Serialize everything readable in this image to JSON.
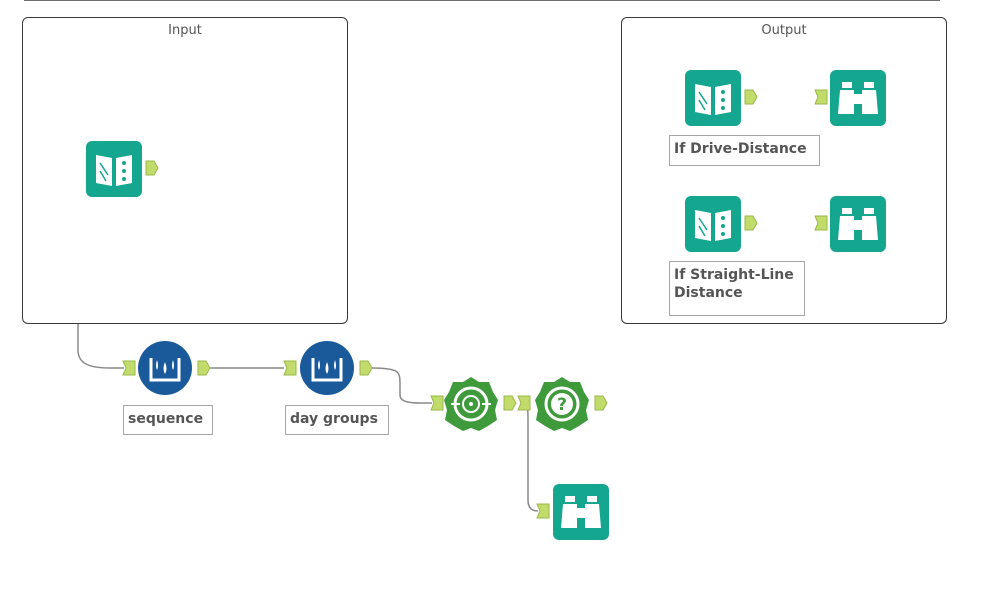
{
  "containers": {
    "input": {
      "title": "Input"
    },
    "output": {
      "title": "Output"
    }
  },
  "tools": {
    "input_data": {
      "icon": "book-icon",
      "type": "Input Data"
    },
    "multi_row_1": {
      "icon": "multi-row-formula-icon",
      "type": "Multi-Row Formula"
    },
    "multi_row_2": {
      "icon": "multi-row-formula-icon",
      "type": "Multi-Row Formula"
    },
    "spatial_1": {
      "icon": "spatial-process-icon",
      "type": "Spatial"
    },
    "spatial_2": {
      "icon": "spatial-question-icon",
      "type": "Spatial"
    },
    "browse_main": {
      "icon": "binoculars-icon",
      "type": "Browse"
    },
    "out_input_1": {
      "icon": "book-icon",
      "type": "Input Data"
    },
    "out_browse_1": {
      "icon": "binoculars-icon",
      "type": "Browse"
    },
    "out_input_2": {
      "icon": "book-icon",
      "type": "Input Data"
    },
    "out_browse_2": {
      "icon": "binoculars-icon",
      "type": "Browse"
    }
  },
  "annotations": {
    "sequence": "sequence",
    "day_groups": "day groups",
    "drive_distance": "If Drive-Distance",
    "straight_line_1": "If Straight-Line",
    "straight_line_2": "Distance"
  },
  "colors": {
    "teal": "#14a68e",
    "navy": "#1b5a9a",
    "green": "#3f9a3c",
    "anchor": "#c2dc6b"
  }
}
